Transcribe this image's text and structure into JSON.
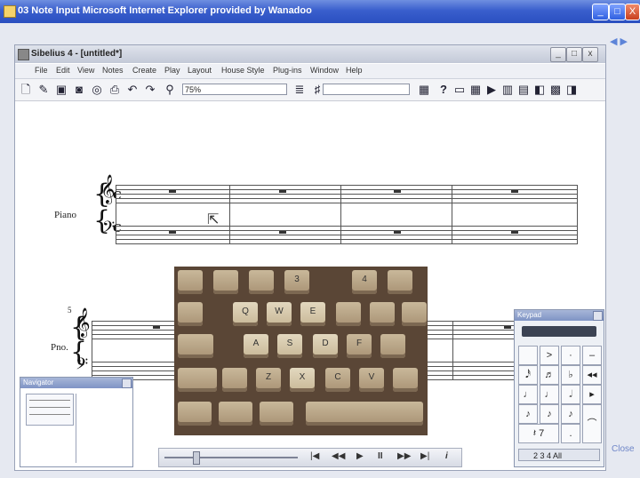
{
  "ie": {
    "title": "03 Note Input   Microsoft Internet Explorer provided by Wanadoo",
    "buttons": {
      "minimize": "_",
      "maximize": "□",
      "close": "X"
    }
  },
  "sibelius": {
    "title": "Sibelius 4 - [untitled*]",
    "menu": [
      "File",
      "Edit",
      "View",
      "Notes",
      "Create",
      "Play",
      "Layout",
      "House Style",
      "Plug-ins",
      "Window",
      "Help"
    ],
    "zoom": "75%",
    "toolbar_question": "?"
  },
  "score": {
    "system1_instrument": "Piano",
    "system2_instrument": "Pno.",
    "system2_bar_number": "5",
    "time_signature": "C"
  },
  "keyboard_video": {
    "row1_keys": [
      "",
      "",
      "",
      "3",
      "4",
      "",
      ""
    ],
    "row2_keys": [
      "",
      "Q",
      "W",
      "E",
      "",
      "",
      ""
    ],
    "row3_keys": [
      "",
      "A",
      "S",
      "D",
      "F",
      "",
      ""
    ],
    "row4_keys": [
      "",
      "",
      "Z",
      "X",
      "C",
      "V",
      ""
    ]
  },
  "panels": {
    "navigator_title": "Navigator",
    "keypad_title": "Keypad",
    "keypad_tabs": "2  3  4  All"
  },
  "right_edge": {
    "nav_arrows": "◀ ▶",
    "close_label": "Close"
  },
  "icons": {
    "play": "▶",
    "pause": "II",
    "prev": "|◀",
    "rewind": "◀◀",
    "forward": "▶▶",
    "next": "▶|"
  }
}
